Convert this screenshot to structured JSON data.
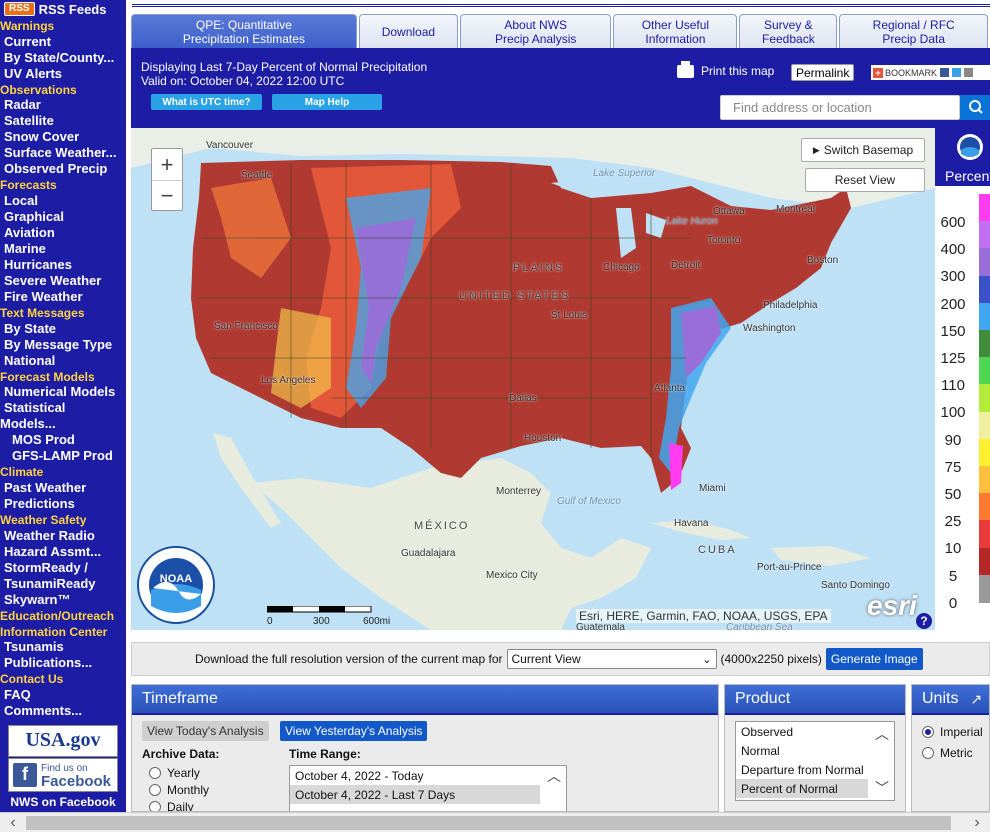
{
  "sidebar": {
    "rss_badge": "RSS",
    "rss_label": "RSS Feeds",
    "groups": [
      {
        "section": "Warnings",
        "items": [
          "Current",
          "By State/County...",
          "UV Alerts"
        ]
      },
      {
        "section": "Observations",
        "items": [
          "Radar",
          "Satellite",
          "Snow Cover",
          "Surface Weather...",
          "Observed Precip"
        ]
      },
      {
        "section": "Forecasts",
        "items": [
          "Local",
          "Graphical",
          "Aviation",
          "Marine",
          "Hurricanes",
          "Severe Weather",
          "Fire Weather"
        ]
      },
      {
        "section": "Text Messages",
        "items": [
          "By State",
          "By Message Type",
          "National"
        ]
      },
      {
        "section": "Forecast Models",
        "items": [
          "Numerical Models",
          "Statistical",
          "Models...",
          "MOS Prod",
          "GFS-LAMP Prod"
        ]
      },
      {
        "section": "Climate",
        "items": [
          "Past Weather",
          "Predictions"
        ]
      },
      {
        "section": "Weather Safety",
        "items": [
          "Weather Radio",
          "Hazard Assmt...",
          "StormReady /",
          "TsunamiReady",
          "Skywarn™"
        ]
      },
      {
        "section": "Education/Outreach",
        "items": []
      },
      {
        "section": "Information Center",
        "items": [
          "Tsunamis",
          "Publications..."
        ]
      },
      {
        "section": "Contact Us",
        "items": [
          "FAQ",
          "Comments..."
        ]
      }
    ],
    "usagov": "USA.gov",
    "fb_line1": "Find us on",
    "fb_line2": "Facebook",
    "nws_fb": "NWS on Facebook"
  },
  "tabs": [
    {
      "line1": "QPE: Quantitative",
      "line2": "Precipitation Estimates",
      "active": true
    },
    {
      "line1": "Download",
      "line2": "",
      "active": false
    },
    {
      "line1": "About NWS",
      "line2": "Precip Analysis",
      "active": false
    },
    {
      "line1": "Other Useful",
      "line2": "Information",
      "active": false
    },
    {
      "line1": "Survey &",
      "line2": "Feedback",
      "active": false
    },
    {
      "line1": "Regional / RFC",
      "line2": "Precip Data",
      "active": false
    }
  ],
  "header": {
    "displaying": "Displaying Last 7-Day Percent of Normal Precipitation",
    "valid_on": "Valid on: October 04, 2022 12:00 UTC",
    "utc_button": "What is UTC time?",
    "maphelp_button": "Map Help",
    "print_label": "Print this map",
    "permalink_label": "Permalink",
    "bookmark_label": "BOOKMARK",
    "search_placeholder": "Find address or location"
  },
  "map": {
    "switch_basemap": "Switch Basemap",
    "reset_view": "Reset View",
    "attribution": "Esri, HERE, Garmin, FAO, NOAA, USGS, EPA",
    "powered_by": "esri",
    "noaa_label": "NOAA",
    "scale_labels": [
      "0",
      "300",
      "600mi"
    ],
    "place_labels": [
      {
        "text": "Vancouver",
        "kind": "city"
      },
      {
        "text": "Seattle",
        "kind": "city"
      },
      {
        "text": "Lake Superior",
        "kind": "water"
      },
      {
        "text": "Ottawa",
        "kind": "city"
      },
      {
        "text": "Montreal",
        "kind": "city"
      },
      {
        "text": "Lake Huron",
        "kind": "water"
      },
      {
        "text": "Toronto",
        "kind": "city"
      },
      {
        "text": "Boston",
        "kind": "city"
      },
      {
        "text": "Chicago",
        "kind": "city"
      },
      {
        "text": "Detroit",
        "kind": "city"
      },
      {
        "text": "PLAINS",
        "kind": "region"
      },
      {
        "text": "UNITED STATES",
        "kind": "country"
      },
      {
        "text": "Philadelphia",
        "kind": "city"
      },
      {
        "text": "Washington",
        "kind": "city"
      },
      {
        "text": "San Francisco",
        "kind": "city"
      },
      {
        "text": "St Louis",
        "kind": "city"
      },
      {
        "text": "Los Angeles",
        "kind": "city"
      },
      {
        "text": "Dallas",
        "kind": "city"
      },
      {
        "text": "Atlanta",
        "kind": "city"
      },
      {
        "text": "Houston",
        "kind": "city"
      },
      {
        "text": "Monterrey",
        "kind": "city"
      },
      {
        "text": "Gulf of Mexico",
        "kind": "water"
      },
      {
        "text": "Miami",
        "kind": "city"
      },
      {
        "text": "MÉXICO",
        "kind": "country"
      },
      {
        "text": "Havana",
        "kind": "city"
      },
      {
        "text": "CUBA",
        "kind": "country"
      },
      {
        "text": "Guadalajara",
        "kind": "city"
      },
      {
        "text": "Mexico City",
        "kind": "city"
      },
      {
        "text": "Port-au-Prince",
        "kind": "city"
      },
      {
        "text": "Santo Domingo",
        "kind": "city"
      },
      {
        "text": "Guatemala",
        "kind": "city"
      },
      {
        "text": "Caribbean Sea",
        "kind": "water"
      }
    ]
  },
  "legend": {
    "title": "Percent",
    "ticks": [
      "600",
      "400",
      "300",
      "200",
      "150",
      "125",
      "110",
      "100",
      "90",
      "75",
      "50",
      "25",
      "10",
      "5",
      "0"
    ],
    "colors": [
      "#ff3cf0",
      "#c070f0",
      "#9a6ed8",
      "#3a52c8",
      "#41a7f0",
      "#3f8c3c",
      "#4fd650",
      "#b4ec3c",
      "#f0f0a0",
      "#fff030",
      "#ffc040",
      "#ff7a30",
      "#e83c3c",
      "#b42828",
      "#9a9a9a"
    ]
  },
  "download": {
    "label": "Download the full resolution version of the current map for",
    "select_value": "Current View",
    "size_text": "(4000x2250 pixels)",
    "generate_label": "Generate Image"
  },
  "timeframe": {
    "title": "Timeframe",
    "today_btn": "View Today's Analysis",
    "yesterday_btn": "View Yesterday's Analysis",
    "archive_label": "Archive Data:",
    "archive_options": [
      "Yearly",
      "Monthly",
      "Daily"
    ],
    "range_label": "Time Range:",
    "ranges": [
      "October 4, 2022 - Today",
      "October 4, 2022 - Last 7 Days"
    ]
  },
  "product": {
    "title": "Product",
    "options": [
      "Observed",
      "Normal",
      "Departure from Normal",
      "Percent of Normal"
    ],
    "selected": "Percent of Normal"
  },
  "units": {
    "title": "Units",
    "options": [
      "Imperial",
      "Metric"
    ],
    "selected": "Imperial"
  }
}
